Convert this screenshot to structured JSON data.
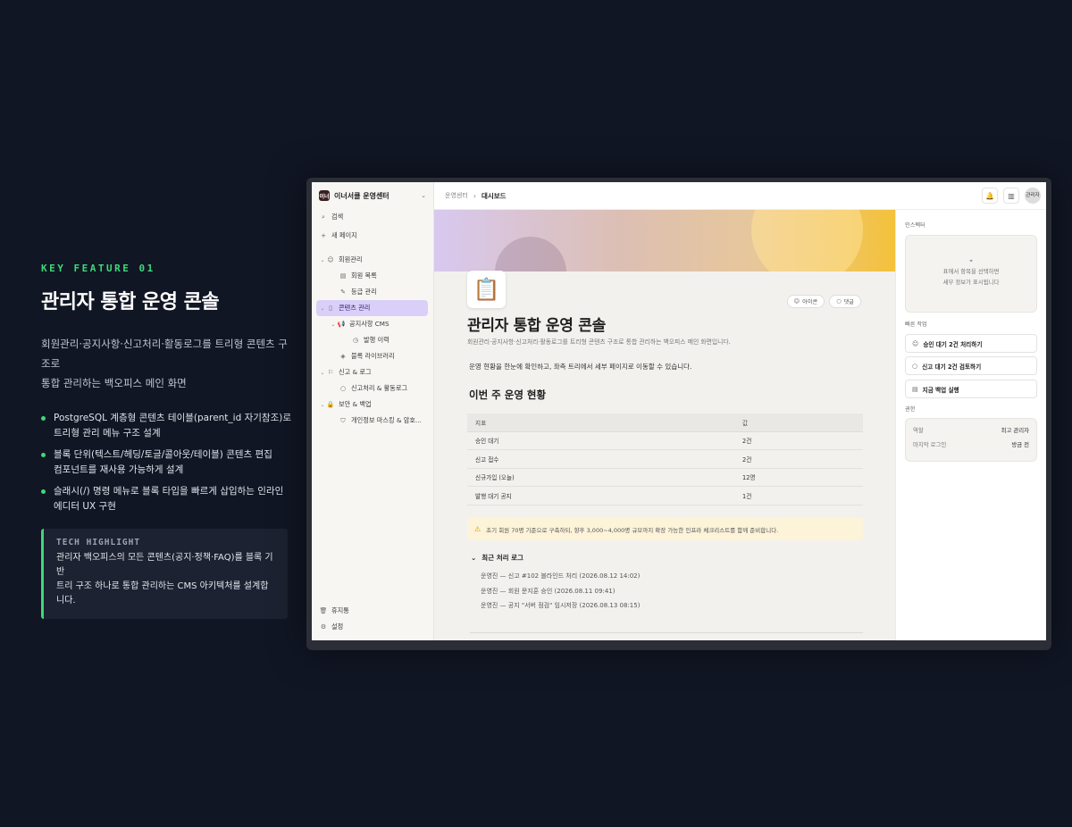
{
  "hero": {
    "kicker": "KEY FEATURE 01",
    "title": "관리자 통합 운영 콘솔",
    "desc_line1": "회원관리·공지사항·신고처리·활동로그를 트리형 콘텐츠 구조로",
    "desc_line2": "통합 관리하는 백오피스 메인 화면",
    "features": [
      {
        "line1": "PostgreSQL 계층형 콘텐츠 테이블(parent_id 자기참조)로",
        "line2": "트리형 관리 메뉴 구조 설계"
      },
      {
        "line1": "블록 단위(텍스트/헤딩/토글/콜아웃/테이블) 콘텐츠 편집",
        "line2": "컴포넌트를 재사용 가능하게 설계"
      },
      {
        "line1": "슬래시(/) 명령 메뉴로 블록 타입을 빠르게 삽입하는 인라인",
        "line2": "에디터 UX 구현"
      }
    ],
    "highlight_title": "TECH HIGHLIGHT",
    "highlight_line1": "관리자 백오피스의 모든 콘텐츠(공지·정책·FAQ)를 블록 기반",
    "highlight_line2": "트리 구조 하나로 통합 관리하는 CMS 아키텍처를 설계합니다."
  },
  "app": {
    "workspace": {
      "logo": "이너",
      "name": "이너서클 운영센터"
    },
    "search": "검색",
    "new_page": "새 페이지",
    "tree": [
      {
        "label": "회원관리"
      },
      {
        "label": "회원 목록"
      },
      {
        "label": "등급 관리"
      },
      {
        "label": "콘텐츠 관리"
      },
      {
        "label": "공지사항 CMS"
      },
      {
        "label": "발행 이력"
      },
      {
        "label": "블록 라이브러리"
      },
      {
        "label": "신고 & 로그"
      },
      {
        "label": "신고처리 & 활동로그"
      },
      {
        "label": "보안 & 백업"
      },
      {
        "label": "개인정보 마스킹 & 암호..."
      }
    ],
    "trash": "휴지통",
    "settings": "설정",
    "breadcrumb": {
      "parent": "운영센터",
      "current": "대시보드"
    },
    "avatar_text": "관리자",
    "page": {
      "icon": "📋",
      "btn_icon": "아이콘",
      "btn_comment": "댓글",
      "title": "관리자 통합 운영 콘솔",
      "subtitle": "회원관리·공지사항·신고처리·활동로그를 트리형 콘텐츠 구조로 통합 관리하는 백오피스 메인 화면입니다.",
      "note": "운영 현황을 한눈에 확인하고, 좌측 트리에서 세부 페이지로 이동할 수 있습니다.",
      "section_title": "이번 주 운영 현황",
      "table": {
        "headers": [
          "지표",
          "값"
        ],
        "rows": [
          [
            "승인 대기",
            "2건"
          ],
          [
            "신고 접수",
            "2건"
          ],
          [
            "신규가입 (오늘)",
            "12명"
          ],
          [
            "발행 대기 공지",
            "1건"
          ]
        ]
      },
      "callout": "초기 회원 70명 기준으로 구축하되, 향후 3,000~4,000명 규모까지 확장 가능한 인프라 체크리스트를 함께 준비합니다.",
      "toggle_title": "최근 처리 로그",
      "logs": [
        "운영진 — 신고 #102 블라인드 처리 (2026.08.12 14:02)",
        "운영진 — 회원 문지훈 승인 (2026.08.11 09:41)",
        "운영진 — 공지 \"서버 점검\" 임시저장 (2026.08.13 08:15)"
      ]
    },
    "inspector": {
      "label": "인스펙터",
      "empty_line1": "표에서 항목을 선택하면",
      "empty_line2": "세부 정보가 표시됩니다",
      "quick_label": "빠른 작업",
      "actions": [
        "승인 대기 2건 처리하기",
        "신고 대기 2건 검토하기",
        "지금 백업 실행"
      ],
      "perm_label": "권한",
      "perm": [
        {
          "k": "역할",
          "v": "최고 관리자"
        },
        {
          "k": "마지막 로그인",
          "v": "방금 전"
        }
      ]
    }
  },
  "colors": {
    "accent": "#3fd878",
    "background": "#111624",
    "active_item": "#d9cff8"
  }
}
